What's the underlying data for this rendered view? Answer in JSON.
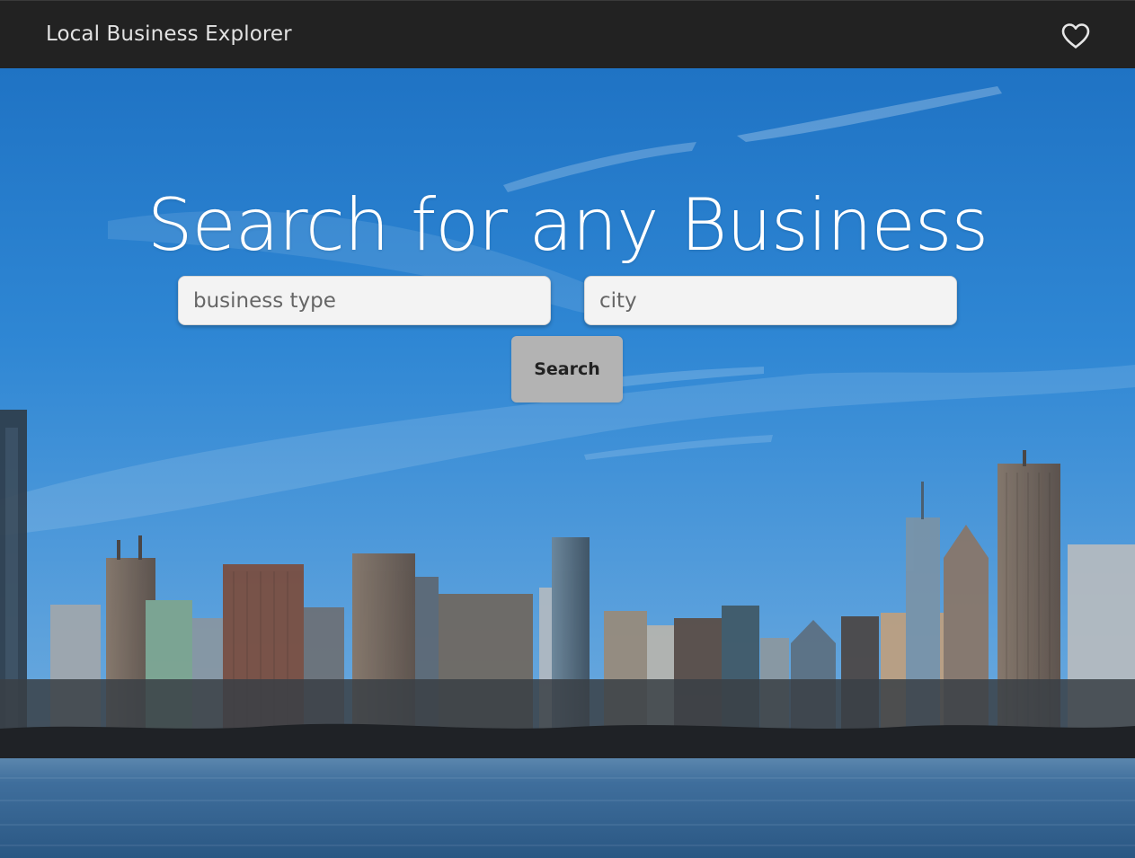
{
  "navbar": {
    "brand": "Local Business Explorer",
    "favorites_icon": "heart-outline-icon"
  },
  "hero": {
    "headline": "Search for any Business",
    "background": "city-skyline-waterfront-photo",
    "business_type_field": {
      "placeholder": "business type",
      "value": ""
    },
    "city_field": {
      "placeholder": "city",
      "value": ""
    },
    "search_label": "Search"
  },
  "colors": {
    "navbar_bg": "#222222",
    "brand_text": "#e2e2e2",
    "sky_top": "#1f76c6",
    "sky_bottom": "#6ea9de",
    "water": "#2f5f8c",
    "button_bg": "#b3b3b3",
    "input_bg": "#f3f3f3"
  }
}
